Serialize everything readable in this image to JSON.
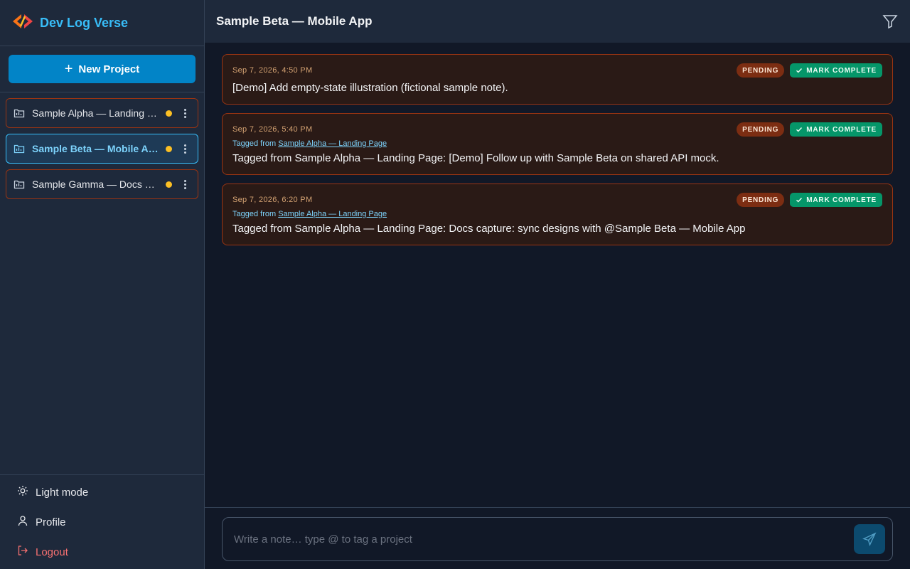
{
  "app": {
    "name": "Dev Log Verse"
  },
  "sidebar": {
    "new_project_label": "New Project",
    "projects": [
      {
        "name": "Sample Alpha — Landing Page",
        "status_color": "#fbbf24",
        "active": false
      },
      {
        "name": "Sample Beta — Mobile App",
        "status_color": "#fbbf24",
        "active": true
      },
      {
        "name": "Sample Gamma — Docs Site",
        "status_color": "#fbbf24",
        "active": false
      }
    ],
    "footer": {
      "light_mode": "Light mode",
      "profile": "Profile",
      "logout": "Logout"
    }
  },
  "header": {
    "title": "Sample Beta — Mobile App"
  },
  "notes": [
    {
      "timestamp": "Sep 7, 2026, 4:50 PM",
      "status": "PENDING",
      "action": "MARK COMPLETE",
      "tagged_prefix": "",
      "tagged_link": "",
      "body": "[Demo] Add empty-state illustration (fictional sample note)."
    },
    {
      "timestamp": "Sep 7, 2026, 5:40 PM",
      "status": "PENDING",
      "action": "MARK COMPLETE",
      "tagged_prefix": "Tagged from",
      "tagged_link": "Sample Alpha — Landing Page",
      "body": "Tagged from Sample Alpha — Landing Page: [Demo] Follow up with Sample Beta on shared API mock."
    },
    {
      "timestamp": "Sep 7, 2026, 6:20 PM",
      "status": "PENDING",
      "action": "MARK COMPLETE",
      "tagged_prefix": "Tagged from",
      "tagged_link": "Sample Alpha — Landing Page",
      "body": "Tagged from Sample Alpha — Landing Page: Docs capture: sync designs with @Sample Beta — Mobile App"
    }
  ],
  "composer": {
    "placeholder": "Write a note… type @ to tag a project"
  },
  "colors": {
    "accent": "#0284c7",
    "brand_text": "#38bdf8",
    "pending": "#7c2d12",
    "complete": "#059669",
    "logout": "#f87171"
  }
}
